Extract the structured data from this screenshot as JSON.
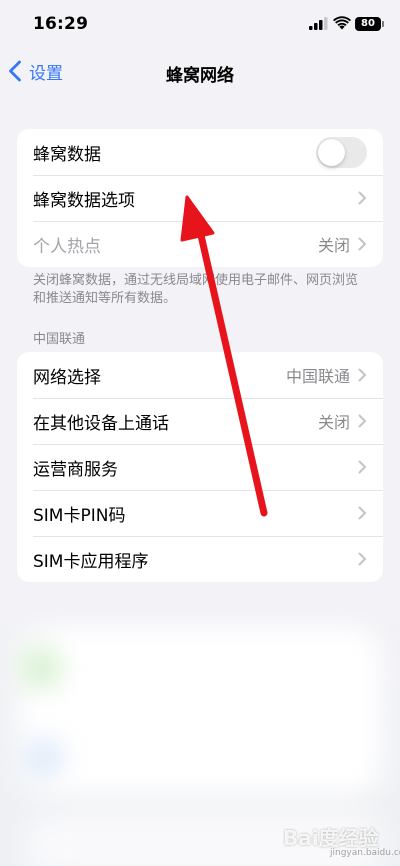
{
  "status_bar": {
    "time": "16:29",
    "battery": "80"
  },
  "nav": {
    "back_label": "设置",
    "title": "蜂窝网络"
  },
  "group1": {
    "cellular_data_label": "蜂窝数据",
    "cellular_data_on": false,
    "cellular_options_label": "蜂窝数据选项",
    "hotspot_label": "个人热点",
    "hotspot_value": "关闭"
  },
  "footer_note": "关闭蜂窝数据，通过无线局域网使用电子邮件、网页浏览和推送通知等所有数据。",
  "carrier_section": {
    "header": "中国联通",
    "rows": [
      {
        "label": "网络选择",
        "value": "中国联通"
      },
      {
        "label": "在其他设备上通话",
        "value": "关闭"
      },
      {
        "label": "运营商服务",
        "value": ""
      },
      {
        "label": "SIM卡PIN码",
        "value": ""
      },
      {
        "label": "SIM卡应用程序",
        "value": ""
      }
    ]
  },
  "watermark": {
    "text": "Bai度经验",
    "sub": "jingyan.baidu.com"
  },
  "colors": {
    "accent": "#3478f6",
    "annotation_arrow": "#e8141c",
    "toggle_off": "#e9e9ea"
  },
  "icons": [
    "signal-icon",
    "wifi-icon",
    "battery-icon",
    "back-chevron-icon",
    "chevron-right-icon"
  ]
}
